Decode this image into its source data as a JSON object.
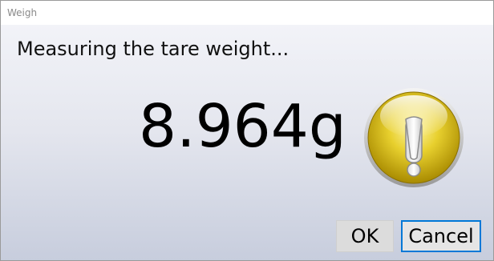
{
  "window": {
    "title": "Weigh"
  },
  "dialog": {
    "message": "Measuring the tare weight...",
    "weight": "8.964g",
    "icon": "warning-exclamation-icon"
  },
  "buttons": {
    "ok_label": "OK",
    "cancel_label": "Cancel"
  },
  "colors": {
    "focus_border": "#0078d7",
    "icon_gold": "#d4b800"
  }
}
